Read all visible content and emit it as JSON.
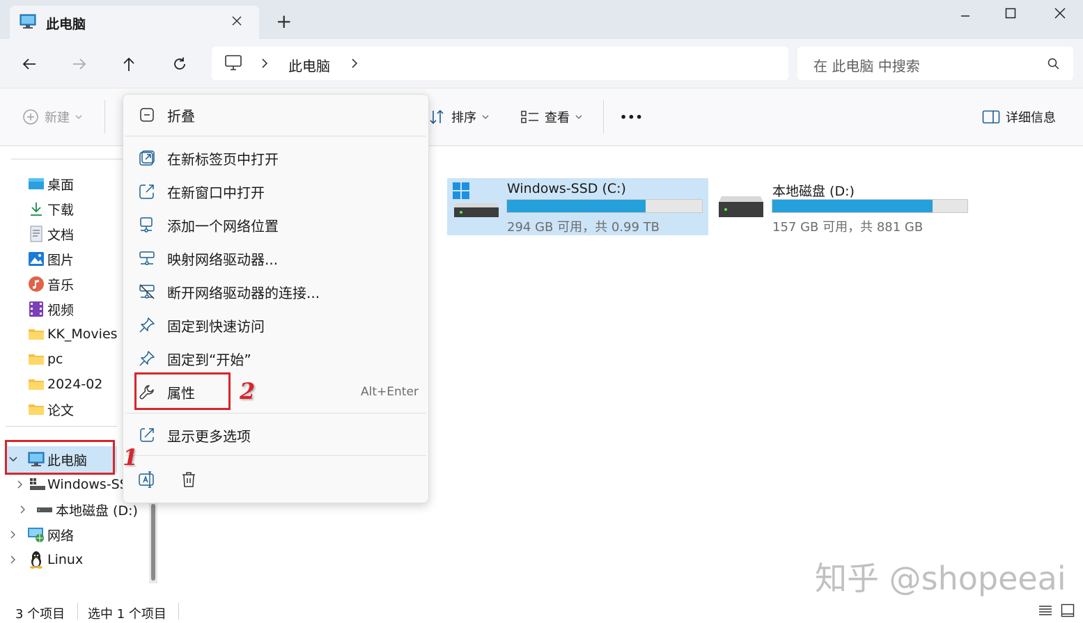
{
  "window": {
    "tab_title": "此电脑",
    "new_tab": "+"
  },
  "address": {
    "path": [
      "此电脑"
    ],
    "search_placeholder": "在 此电脑 中搜索"
  },
  "toolbar": {
    "new_label": "新建",
    "sort_label": "排序",
    "view_label": "查看",
    "more_label": "•••",
    "details_label": "详细信息"
  },
  "sidebar": {
    "items": [
      {
        "label": "桌面",
        "icon": "desktop-icon"
      },
      {
        "label": "下载",
        "icon": "download-icon"
      },
      {
        "label": "文档",
        "icon": "document-icon"
      },
      {
        "label": "图片",
        "icon": "picture-icon"
      },
      {
        "label": "音乐",
        "icon": "music-icon"
      },
      {
        "label": "视频",
        "icon": "video-icon"
      },
      {
        "label": "KK_Movies",
        "icon": "folder-icon"
      },
      {
        "label": "pc",
        "icon": "folder-icon"
      },
      {
        "label": "2024-02",
        "icon": "folder-icon"
      },
      {
        "label": "论文",
        "icon": "folder-icon"
      },
      {
        "label": "此电脑",
        "icon": "computer-icon"
      },
      {
        "label": "Windows-SSD (C:)",
        "icon": "windows-drive-icon"
      },
      {
        "label": "本地磁盘 (D:)",
        "icon": "drive-icon"
      },
      {
        "label": "网络",
        "icon": "network-icon"
      },
      {
        "label": "Linux",
        "icon": "linux-icon"
      }
    ]
  },
  "drives": [
    {
      "name": "Windows-SSD (C:)",
      "free": "294 GB 可用，共 0.99 TB",
      "used_fraction": 0.71
    },
    {
      "name": "本地磁盘 (D:)",
      "free": "157 GB 可用，共 881 GB",
      "used_fraction": 0.82
    }
  ],
  "context_menu": {
    "items": [
      {
        "label": "折叠",
        "icon": "collapse-icon"
      },
      {
        "label": "在新标签页中打开",
        "icon": "open-new-tab-icon"
      },
      {
        "label": "在新窗口中打开",
        "icon": "open-new-window-icon"
      },
      {
        "label": "添加一个网络位置",
        "icon": "add-network-location-icon"
      },
      {
        "label": "映射网络驱动器...",
        "icon": "map-network-drive-icon"
      },
      {
        "label": "断开网络驱动器的连接...",
        "icon": "disconnect-network-drive-icon"
      },
      {
        "label": "固定到快速访问",
        "icon": "pin-icon"
      },
      {
        "label": "固定到“开始”",
        "icon": "pin-start-icon"
      },
      {
        "label": "属性",
        "icon": "wrench-icon",
        "shortcut": "Alt+Enter"
      },
      {
        "label": "显示更多选项",
        "icon": "more-options-icon"
      }
    ]
  },
  "annotations": {
    "one": "1",
    "two": "2"
  },
  "status": {
    "item_count": "3 个项目",
    "selected": "选中 1 个项目"
  },
  "watermark": "知乎 @shopeeai",
  "colors": {
    "accent": "#26a0da",
    "selection": "#cce4f7",
    "annotation": "#d7262a"
  }
}
